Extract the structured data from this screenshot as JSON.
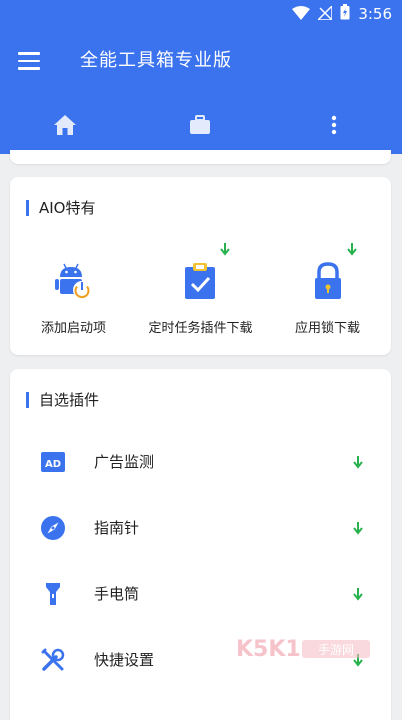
{
  "status_bar": {
    "time": "3:56"
  },
  "app_bar": {
    "title": "全能工具箱专业版"
  },
  "tabs": [
    {
      "icon": "home-icon"
    },
    {
      "icon": "briefcase-icon"
    },
    {
      "icon": "more-vertical-icon",
      "selected": true
    }
  ],
  "aio_section": {
    "title": "AIO特有",
    "items": [
      {
        "label": "添加启动项",
        "icon": "android-power-icon",
        "download": false
      },
      {
        "label": "定时任务插件下载",
        "icon": "clipboard-check-icon",
        "download": true
      },
      {
        "label": "应用锁下载",
        "icon": "lock-icon",
        "download": true
      }
    ]
  },
  "plugins_section": {
    "title": "自选插件",
    "items": [
      {
        "label": "广告监测",
        "icon": "ad-icon"
      },
      {
        "label": "指南针",
        "icon": "compass-icon"
      },
      {
        "label": "手电筒",
        "icon": "flashlight-icon"
      },
      {
        "label": "快捷设置",
        "icon": "tools-icon"
      }
    ]
  },
  "watermark": {
    "text": "K5K1 手游网"
  },
  "colors": {
    "primary": "#3b73ef",
    "download_green": "#28b14c",
    "background": "#eeeff1"
  }
}
